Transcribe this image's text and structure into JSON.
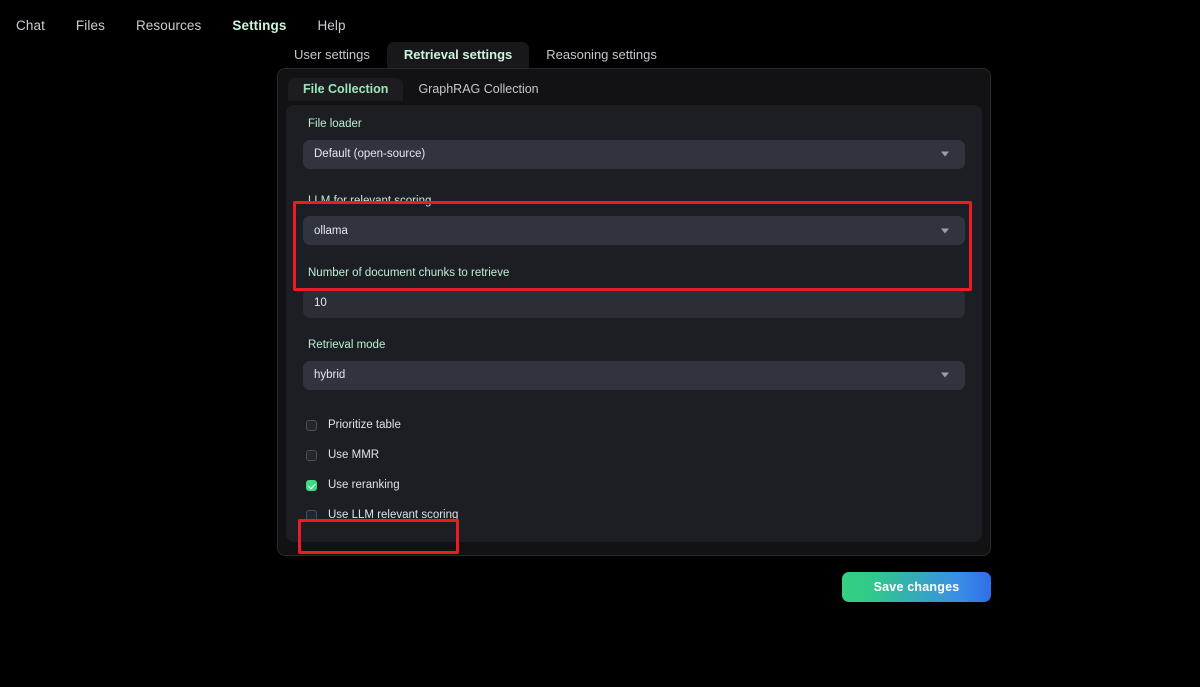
{
  "topnav": {
    "items": [
      {
        "label": "Chat",
        "active": false
      },
      {
        "label": "Files",
        "active": false
      },
      {
        "label": "Resources",
        "active": false
      },
      {
        "label": "Settings",
        "active": true
      },
      {
        "label": "Help",
        "active": false
      }
    ]
  },
  "tabs": [
    {
      "label": "User settings",
      "active": false
    },
    {
      "label": "Retrieval settings",
      "active": true
    },
    {
      "label": "Reasoning settings",
      "active": false
    }
  ],
  "subtabs": [
    {
      "label": "File Collection",
      "active": true
    },
    {
      "label": "GraphRAG Collection",
      "active": false
    }
  ],
  "fields": {
    "file_loader": {
      "label": "File loader",
      "value": "Default (open-source)"
    },
    "llm_scoring": {
      "label": "LLM for relevant scoring",
      "value": "ollama"
    },
    "num_chunks": {
      "label": "Number of document chunks to retrieve",
      "value": "10"
    },
    "retrieval_mode": {
      "label": "Retrieval mode",
      "value": "hybrid"
    }
  },
  "checkboxes": [
    {
      "label": "Prioritize table",
      "checked": false
    },
    {
      "label": "Use MMR",
      "checked": false
    },
    {
      "label": "Use reranking",
      "checked": true
    },
    {
      "label": "Use LLM relevant scoring",
      "checked": false
    }
  ],
  "footer": {
    "save_label": "Save changes"
  },
  "colors": {
    "accent_green": "#3ddc84",
    "label_green": "#b9f0d2",
    "annotation_red": "#ec1c24",
    "background": "#000000",
    "panel": "#1d1e23",
    "control": "#31343f"
  }
}
